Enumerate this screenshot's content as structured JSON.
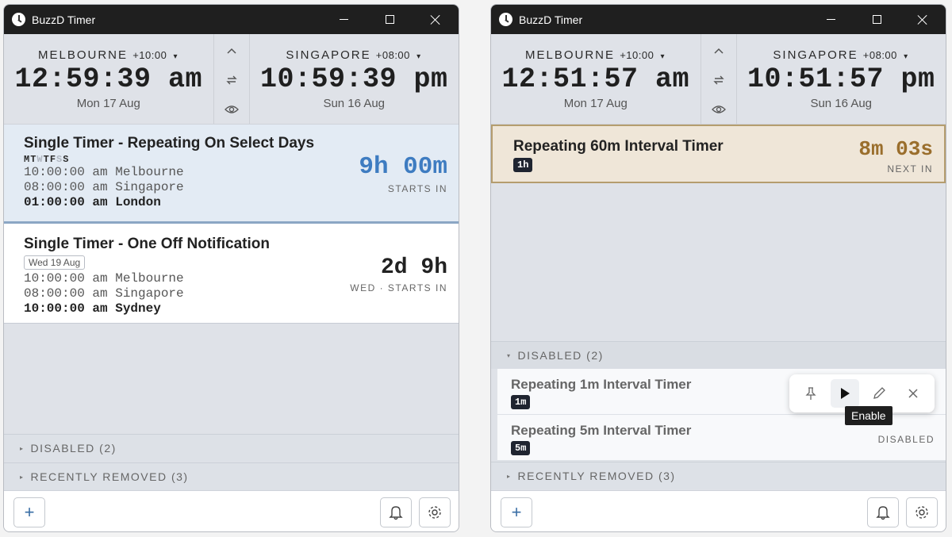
{
  "app": {
    "title": "BuzzD Timer"
  },
  "left": {
    "clock_left": {
      "city": "MELBOURNE",
      "offset": "+10:00",
      "time": "12:59:39 am",
      "date": "Mon 17 Aug"
    },
    "clock_right": {
      "city": "SINGAPORE",
      "offset": "+08:00",
      "time": "10:59:39 pm",
      "date": "Sun 16 Aug"
    },
    "timer1": {
      "title": "Single Timer - Repeating On Select Days",
      "days": [
        "M",
        "T",
        "W",
        "T",
        "F",
        "S",
        "S"
      ],
      "lines": [
        "10:00:00 am Melbourne",
        "08:00:00 am Singapore",
        "01:00:00 am London"
      ],
      "big": "9h 00m",
      "sub": "STARTS IN",
      "color": "#3e7cc1"
    },
    "timer2": {
      "title": "Single Timer - One Off Notification",
      "date_badge": "Wed 19 Aug",
      "lines": [
        "10:00:00 am Melbourne",
        "08:00:00 am Singapore",
        "10:00:00 am Sydney"
      ],
      "big": "2d 9h",
      "sub": "WED · STARTS IN"
    },
    "disabled": "DISABLED (2)",
    "removed": "RECENTLY REMOVED (3)"
  },
  "right": {
    "clock_left": {
      "city": "MELBOURNE",
      "offset": "+10:00",
      "time": "12:51:57 am",
      "date": "Mon 17 Aug"
    },
    "clock_right": {
      "city": "SINGAPORE",
      "offset": "+08:00",
      "time": "10:51:57 pm",
      "date": "Sun 16 Aug"
    },
    "timer1": {
      "title": "Repeating 60m Interval Timer",
      "badge": "1h",
      "big": "8m 03s",
      "sub": "NEXT IN",
      "color": "#9a6e2c",
      "bg": "#efe6d8"
    },
    "disabled": "DISABLED (2)",
    "dis1": {
      "title": "Repeating 1m Interval Timer",
      "badge": "1m"
    },
    "dis2": {
      "title": "Repeating 5m Interval Timer",
      "badge": "5m",
      "status": "DISABLED"
    },
    "tooltip": "Enable",
    "removed": "RECENTLY REMOVED (3)"
  },
  "icons": {
    "add": "+",
    "caret": "▾",
    "tri_open": "▾",
    "tri_closed": "▸"
  }
}
